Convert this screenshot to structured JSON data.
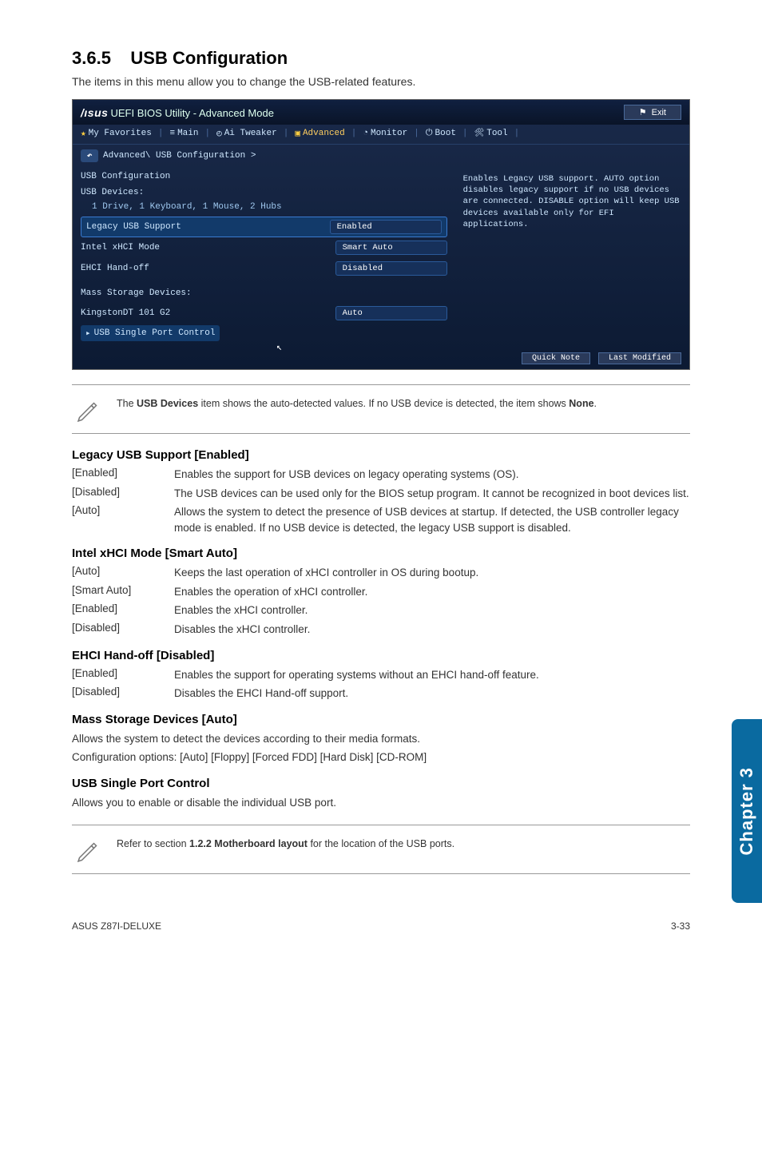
{
  "section_num": "3.6.5",
  "section_title": "USB Configuration",
  "intro": "The items in this menu allow you to change the USB-related features.",
  "bios": {
    "brand": "/ısus",
    "mode": "UEFI BIOS Utility - Advanced Mode",
    "exit": "Exit",
    "tabs": {
      "fav": "My Favorites",
      "main": "Main",
      "ai": "Ai Tweaker",
      "adv": "Advanced",
      "mon": "Monitor",
      "boot": "Boot",
      "tool": "Tool"
    },
    "crumb": "Advanced\\ USB Configuration >",
    "hdr": "USB Configuration",
    "devlabel": "USB Devices:",
    "devlist": "1 Drive, 1 Keyboard, 1 Mouse, 2 Hubs",
    "rows": {
      "legacy": {
        "label": "Legacy USB Support",
        "val": "Enabled"
      },
      "xhci": {
        "label": "Intel xHCI Mode",
        "val": "Smart Auto"
      },
      "ehci": {
        "label": "EHCI Hand-off",
        "val": "Disabled"
      }
    },
    "mass_hdr": "Mass Storage Devices:",
    "mass_row": {
      "label": "KingstonDT 101 G2",
      "val": "Auto"
    },
    "single": "USB Single Port Control",
    "help": "Enables Legacy USB support. AUTO option disables legacy support if no USB devices are connected. DISABLE option will keep USB devices available only for EFI applications.",
    "foot": {
      "quick": "Quick Note",
      "last": "Last Modified"
    }
  },
  "note1": "The USB Devices item shows the auto-detected values. If no USB device is detected, the item shows None.",
  "note1_bold1": "USB Devices",
  "note1_bold2": "None",
  "legacy": {
    "title": "Legacy USB Support [Enabled]",
    "enabled": {
      "k": "[Enabled]",
      "v": "Enables the support for USB devices on legacy operating systems (OS)."
    },
    "disabled": {
      "k": "[Disabled]",
      "v": "The USB devices can be used only for the BIOS setup program. It cannot be recognized in boot devices list."
    },
    "auto": {
      "k": "[Auto]",
      "v": "Allows the system to detect the presence of USB devices at startup. If detected, the USB controller legacy mode is enabled. If no USB device is detected, the legacy USB support is disabled."
    }
  },
  "xhci": {
    "title": "Intel xHCI Mode [Smart Auto]",
    "auto": {
      "k": "[Auto]",
      "v": "Keeps the last operation of xHCI controller in OS during bootup."
    },
    "smart": {
      "k": "[Smart Auto]",
      "v": "Enables the operation of xHCI controller."
    },
    "enabled": {
      "k": "[Enabled]",
      "v": "Enables the xHCI controller."
    },
    "disabled": {
      "k": "[Disabled]",
      "v": "Disables the xHCI controller."
    }
  },
  "ehci": {
    "title": "EHCI Hand-off [Disabled]",
    "enabled": {
      "k": "[Enabled]",
      "v": "Enables the support for operating systems without an EHCI hand-off feature."
    },
    "disabled": {
      "k": "[Disabled]",
      "v": "Disables the EHCI Hand-off support."
    }
  },
  "mass": {
    "title": "Mass Storage Devices [Auto]",
    "line1": "Allows the system to detect the devices according to their media formats.",
    "line2": "Configuration options: [Auto] [Floppy] [Forced FDD] [Hard Disk] [CD-ROM]"
  },
  "usbsingle": {
    "title": "USB Single Port Control",
    "line1": "Allows you to enable or disable the individual USB port."
  },
  "note2_pre": "Refer to section ",
  "note2_bold": "1.2.2 Motherboard layout",
  "note2_post": " for the location of the USB ports.",
  "sidetab": "Chapter 3",
  "footer_left": "ASUS Z87I-DELUXE",
  "footer_right": "3-33"
}
